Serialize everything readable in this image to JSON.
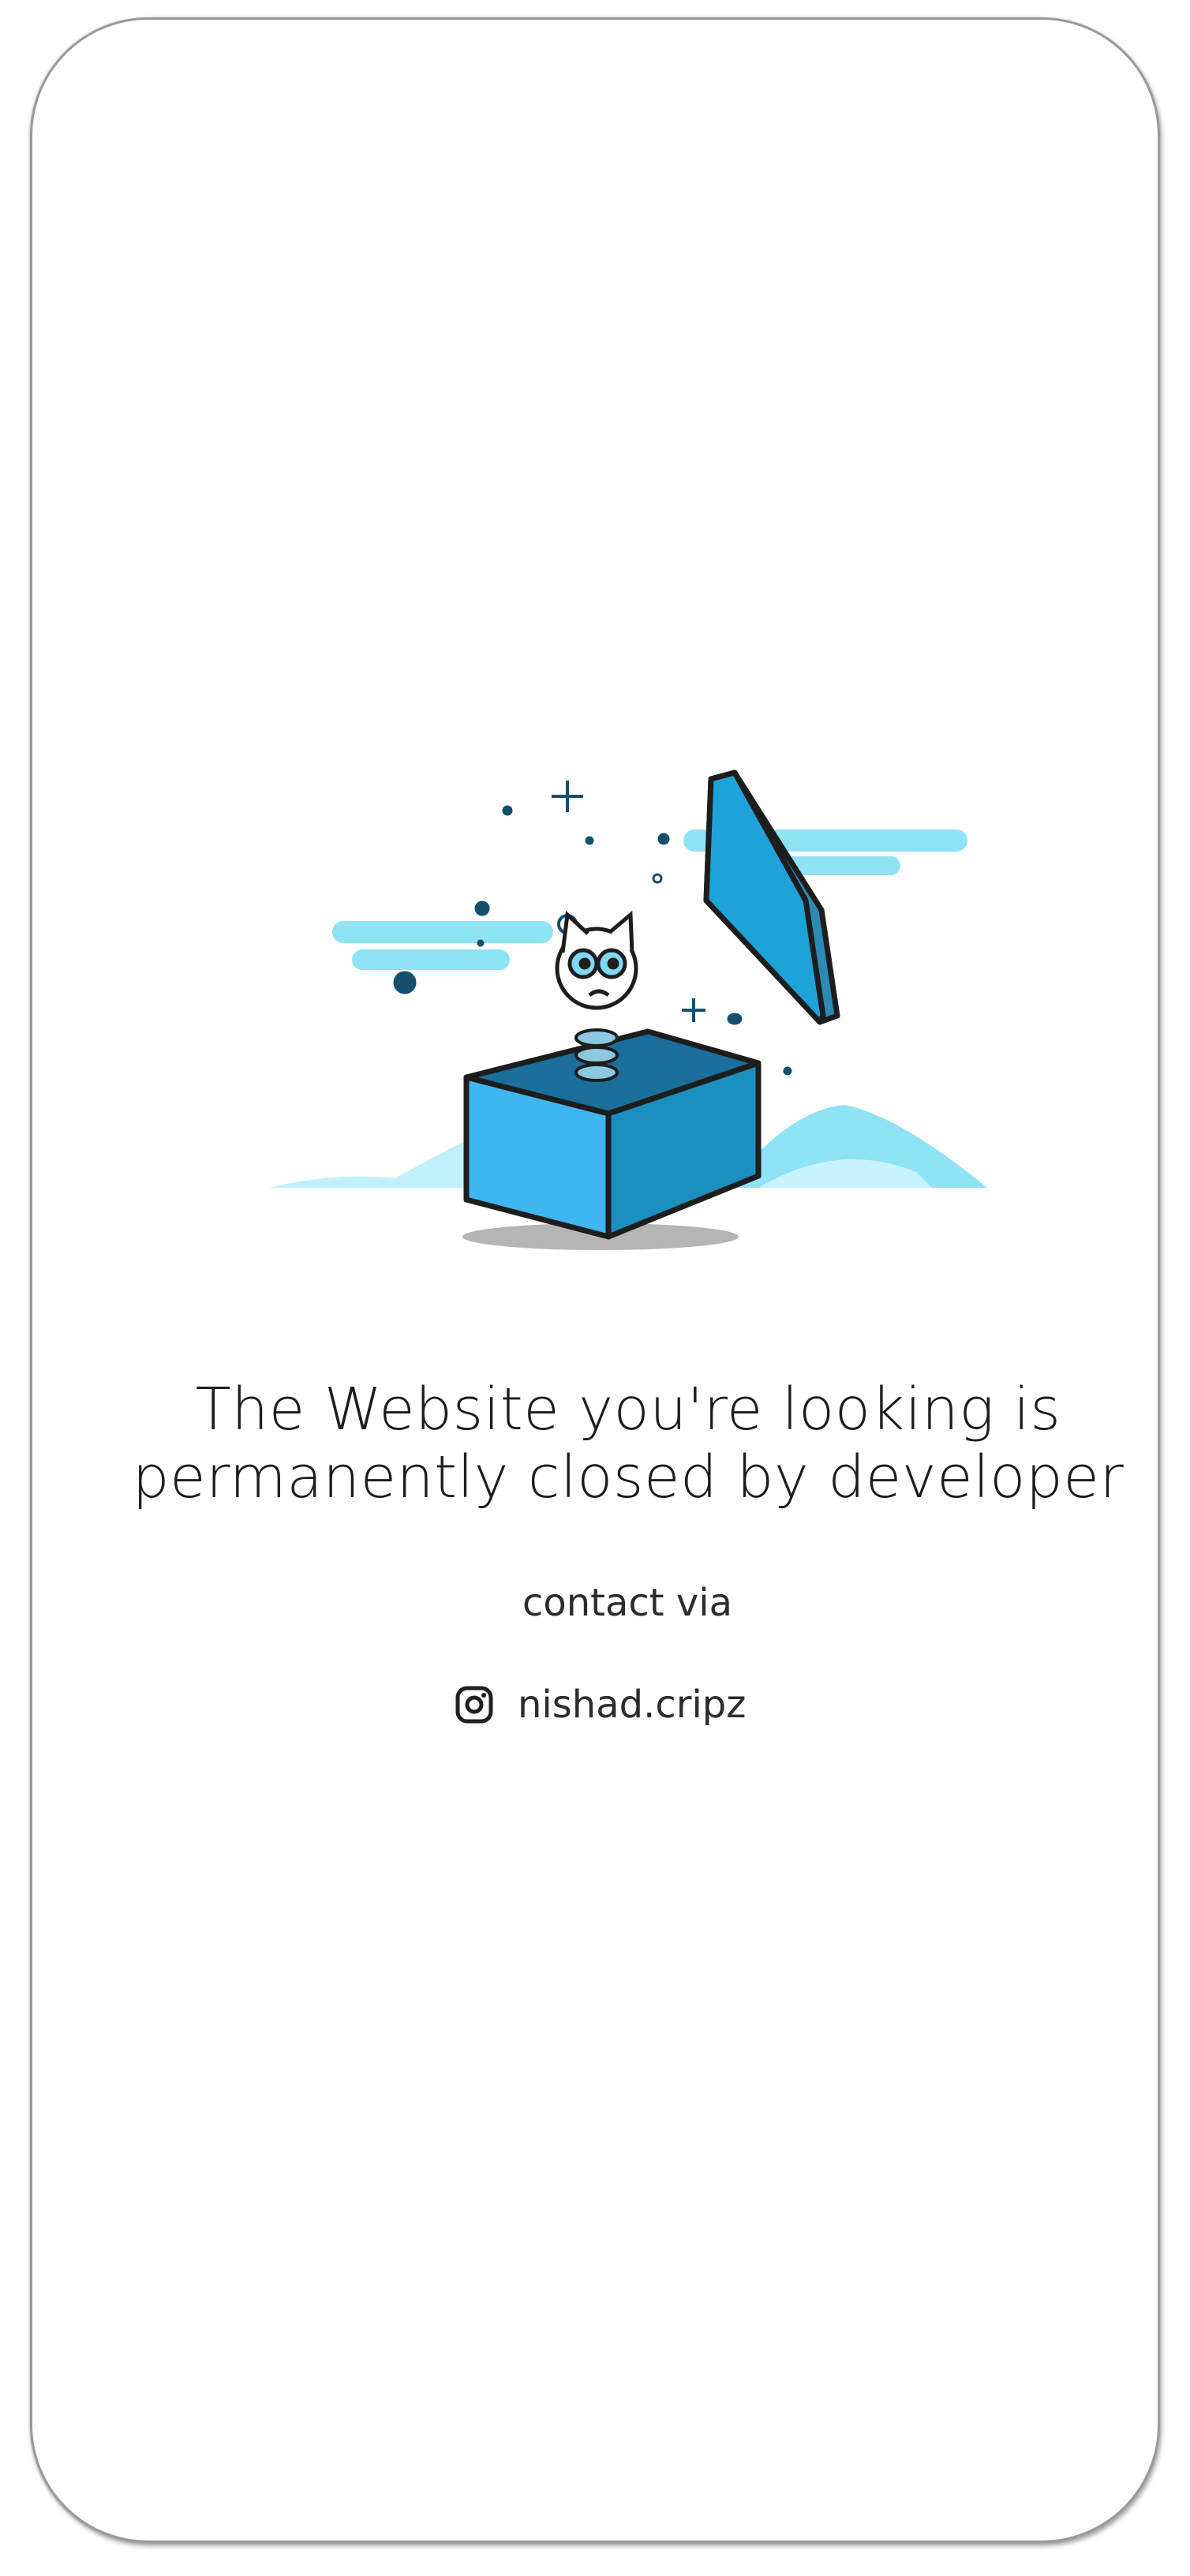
{
  "message": {
    "line1": "The Website you're looking is",
    "line2": "permanently closed by developer"
  },
  "contact": {
    "label": "contact via",
    "instagram_handle": "nishad.cripz",
    "icon": "instagram-icon"
  },
  "illustration": {
    "subject": "jack-in-the-box",
    "colors": {
      "box_light": "#3fb6f0",
      "box_dark": "#1b8fc0",
      "cloud": "#8ee3f5",
      "outline": "#1d1d1d",
      "shadow": "#b5b5b5"
    }
  }
}
